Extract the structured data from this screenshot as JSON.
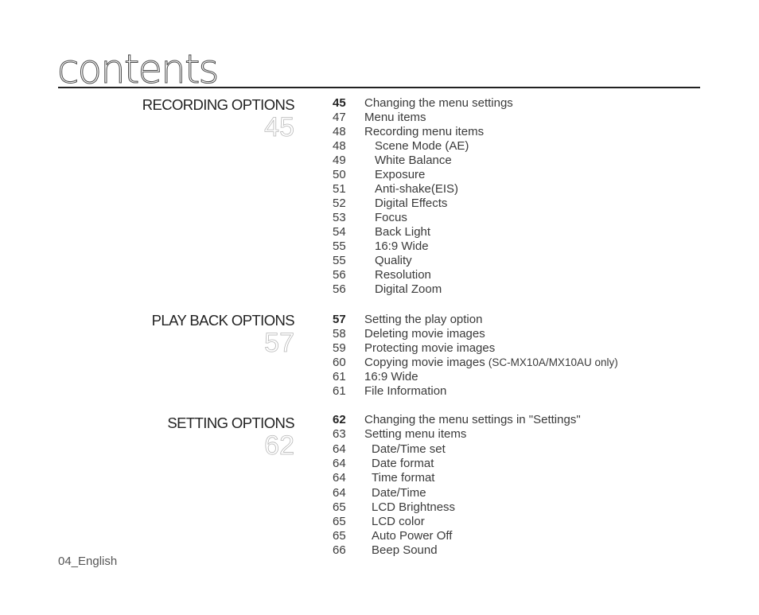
{
  "title": "contents",
  "footer": "04_English",
  "sections": [
    {
      "name": "RECORDING OPTIONS",
      "page": "45",
      "entries": [
        {
          "page": "45",
          "text": "Changing the menu settings",
          "bold": true,
          "level": 0
        },
        {
          "page": "47",
          "text": "Menu items",
          "level": 0
        },
        {
          "page": "48",
          "text": "Recording menu items",
          "level": 0
        },
        {
          "page": "48",
          "text": "Scene Mode (AE)",
          "level": 1
        },
        {
          "page": "49",
          "text": "White Balance",
          "level": 1
        },
        {
          "page": "50",
          "text": "Exposure",
          "level": 1
        },
        {
          "page": "51",
          "text": "Anti-shake(EIS)",
          "level": 1
        },
        {
          "page": "52",
          "text": "Digital Effects",
          "level": 1
        },
        {
          "page": "53",
          "text": "Focus",
          "level": 1
        },
        {
          "page": "54",
          "text": "Back Light",
          "level": 1
        },
        {
          "page": "55",
          "text": "16:9 Wide",
          "level": 1
        },
        {
          "page": "55",
          "text": "Quality",
          "level": 1
        },
        {
          "page": "56",
          "text": "Resolution",
          "level": 1
        },
        {
          "page": "56",
          "text": "Digital Zoom",
          "level": 1
        }
      ]
    },
    {
      "name": "PLAY BACK OPTIONS",
      "page": "57",
      "entries": [
        {
          "page": "57",
          "text": "Setting the play option",
          "bold": true,
          "level": 0
        },
        {
          "page": "58",
          "text": "Deleting movie images",
          "level": 0
        },
        {
          "page": "59",
          "text": "Protecting movie images",
          "level": 0
        },
        {
          "page": "60",
          "text": "Copying movie images",
          "note": "(SC-MX10A/MX10AU only)",
          "level": 0
        },
        {
          "page": "61",
          "text": "16:9 Wide",
          "level": 0
        },
        {
          "page": "61",
          "text": "File Information",
          "level": 0
        }
      ]
    },
    {
      "name": "SETTING OPTIONS",
      "page": "62",
      "entries": [
        {
          "page": "62",
          "text": "Changing the menu settings in \"Settings\"",
          "bold": true,
          "level": 0
        },
        {
          "page": "63",
          "text": "Setting menu items",
          "level": 0
        },
        {
          "page": "64",
          "text": "Date/Time set",
          "level": 2
        },
        {
          "page": "64",
          "text": "Date format",
          "level": 2
        },
        {
          "page": "64",
          "text": "Time format",
          "level": 2
        },
        {
          "page": "64",
          "text": "Date/Time",
          "level": 2
        },
        {
          "page": "65",
          "text": "LCD Brightness",
          "level": 2
        },
        {
          "page": "65",
          "text": "LCD color",
          "level": 2
        },
        {
          "page": "65",
          "text": "Auto Power Off",
          "level": 2
        },
        {
          "page": "66",
          "text": "Beep Sound",
          "level": 2
        }
      ]
    }
  ]
}
